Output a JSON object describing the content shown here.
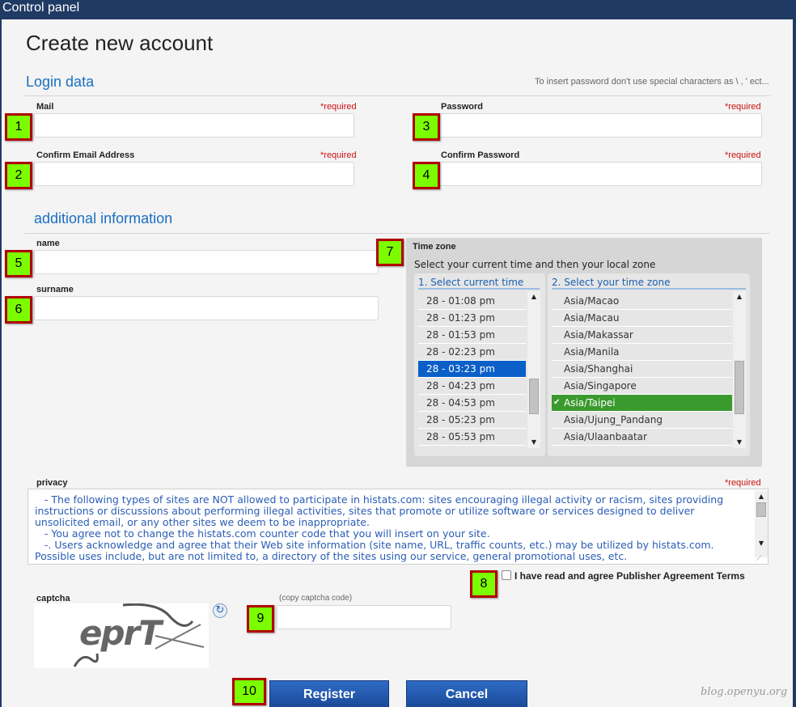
{
  "window": {
    "title": "Control panel"
  },
  "page": {
    "title": "Create new account"
  },
  "login": {
    "section_title": "Login data",
    "hint": "To insert password don't use special characters as \\ , ' ect...",
    "mail_label": "Mail",
    "confirm_email_label": "Confirm Email Address",
    "password_label": "Password",
    "confirm_password_label": "Confirm Password",
    "required": "*required"
  },
  "additional": {
    "section_title": "additional information",
    "name_label": "name",
    "surname_label": "surname"
  },
  "timezone": {
    "title": "Time zone",
    "subtitle": "Select your current time and then your local zone",
    "time_header": "1. Select current time",
    "zone_header": "2. Select your time zone",
    "times": [
      "28 - 01:08 pm",
      "28 - 01:23 pm",
      "28 - 01:53 pm",
      "28 - 02:23 pm",
      "28 - 03:23 pm",
      "28 - 04:23 pm",
      "28 - 04:53 pm",
      "28 - 05:23 pm",
      "28 - 05:53 pm"
    ],
    "selected_time": "28 - 03:23 pm",
    "zones": [
      "Asia/Macao",
      "Asia/Macau",
      "Asia/Makassar",
      "Asia/Manila",
      "Asia/Shanghai",
      "Asia/Singapore",
      "Asia/Taipei",
      "Asia/Ujung_Pandang",
      "Asia/Ulaanbaatar"
    ],
    "selected_zone": "Asia/Taipei",
    "check_mark": "✔"
  },
  "privacy": {
    "label": "privacy",
    "required": "*required",
    "text": "   - The following types of sites are NOT allowed to participate in histats.com: sites encouraging illegal activity or racism, sites providing instructions or discussions about performing illegal activities, sites that promote or utilize software or services designed to deliver unsolicited email, or any other sites we deem to be inappropriate.\n   - You agree not to change the histats.com counter code that you will insert on your site.\n   -. Users acknowledge and agree that their Web site information (site name, URL, traffic counts, etc.) may be utilized by histats.com. Possible uses include, but are not limited to, a directory of the sites using our service, general promotional uses, etc.",
    "agree_label": "I have read and agree Publisher Agreement Terms"
  },
  "captcha": {
    "label": "captcha",
    "hint": "(copy captcha code)",
    "image_text": "eprT"
  },
  "buttons": {
    "register": "Register",
    "cancel": "Cancel"
  },
  "badges": [
    "1",
    "2",
    "3",
    "4",
    "5",
    "6",
    "7",
    "8",
    "9",
    "10"
  ],
  "watermark": "blog.openyu.org",
  "colors": {
    "accent": "#1a6fc2",
    "header": "#1f3b64",
    "required": "#cc1111",
    "badge": "#7cfc00",
    "selected_time": "#0a5fc8",
    "selected_zone": "#3a9a2e"
  }
}
